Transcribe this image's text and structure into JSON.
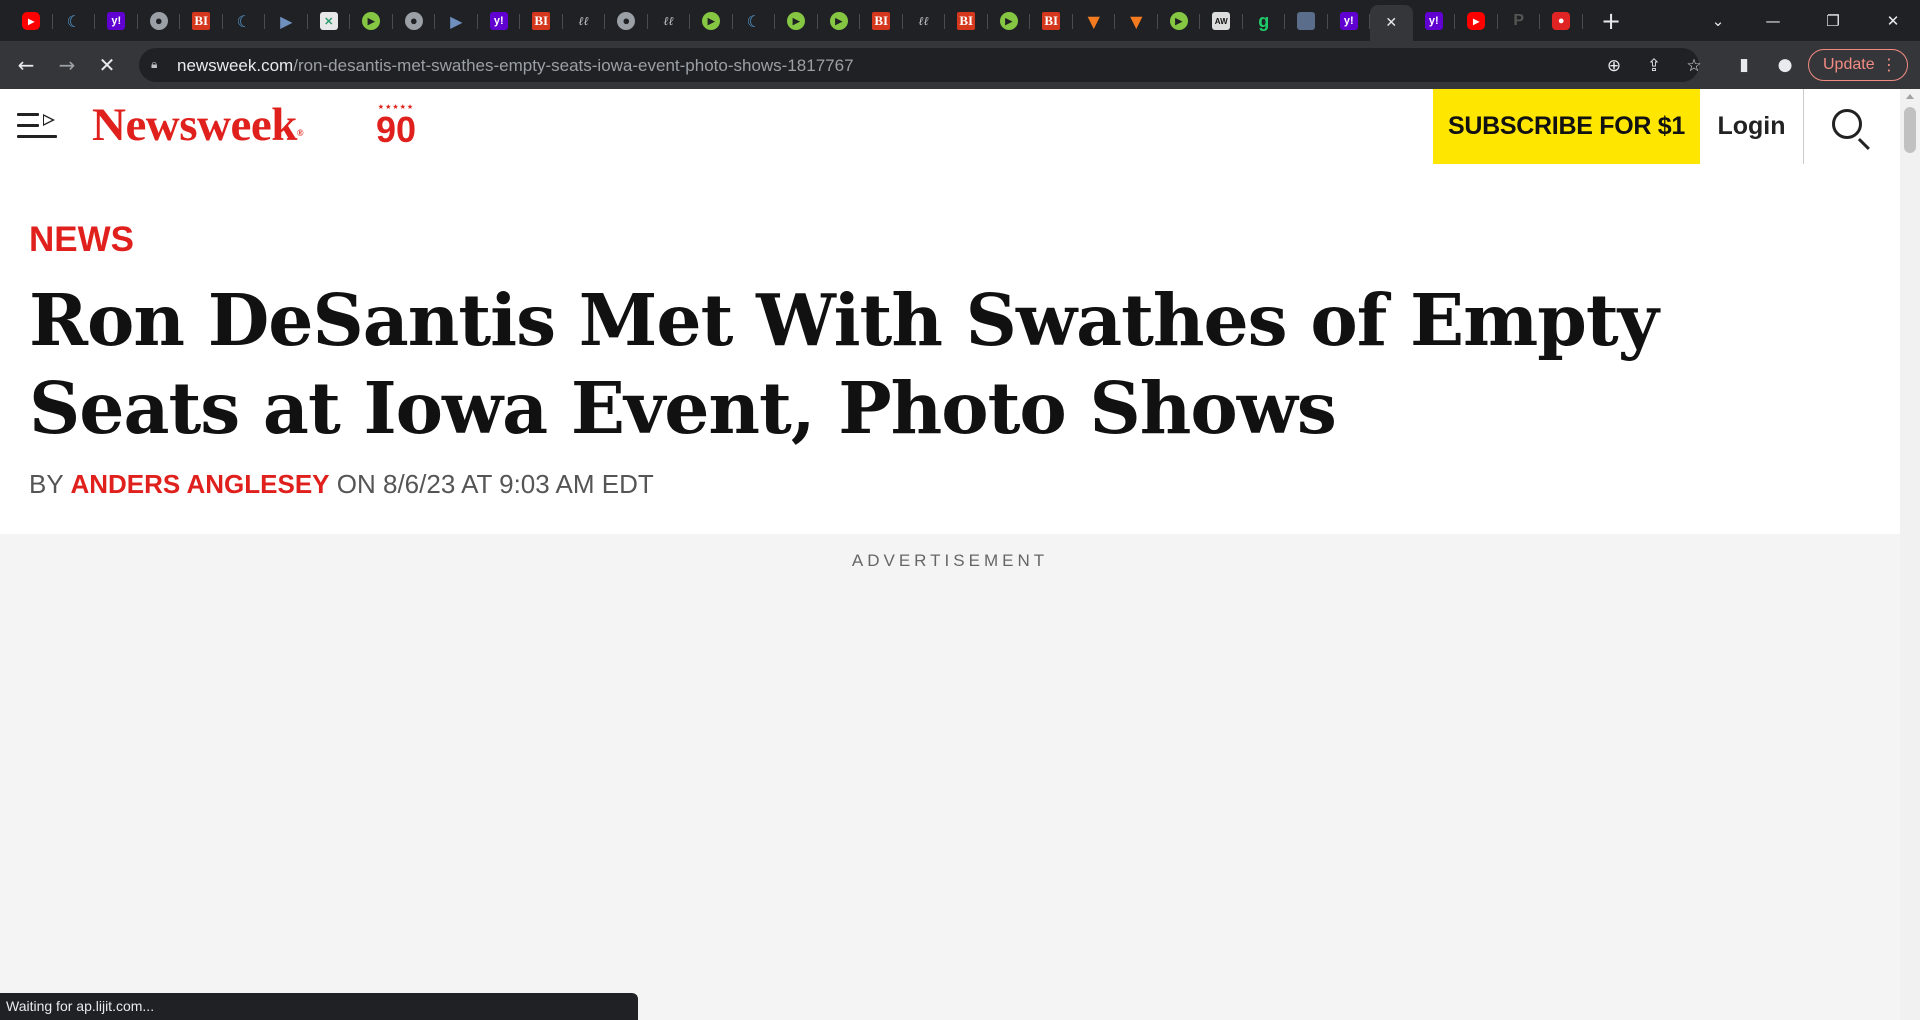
{
  "browser": {
    "tabs": [
      {
        "icon": "youtube-icon",
        "glyph": "▶"
      },
      {
        "icon": "shield-icon",
        "glyph": "☾"
      },
      {
        "icon": "yahoo-icon",
        "glyph": "y!"
      },
      {
        "icon": "globe-icon",
        "glyph": "●"
      },
      {
        "icon": "business-insider-icon",
        "glyph": "BI"
      },
      {
        "icon": "shield-icon",
        "glyph": "☾"
      },
      {
        "icon": "arrow-icon",
        "glyph": "▶"
      },
      {
        "icon": "grid-icon",
        "glyph": "✕"
      },
      {
        "icon": "rumble-icon",
        "glyph": "▶"
      },
      {
        "icon": "globe-icon",
        "glyph": "●"
      },
      {
        "icon": "arrow-icon",
        "glyph": "▶"
      },
      {
        "icon": "yahoo-icon",
        "glyph": "y!"
      },
      {
        "icon": "business-insider-icon",
        "glyph": "BI"
      },
      {
        "icon": "ll-icon",
        "glyph": "ℓℓ"
      },
      {
        "icon": "globe-icon",
        "glyph": "●"
      },
      {
        "icon": "ll-icon",
        "glyph": "ℓℓ"
      },
      {
        "icon": "rumble-icon",
        "glyph": "▶"
      },
      {
        "icon": "shield-icon",
        "glyph": "☾"
      },
      {
        "icon": "rumble-icon",
        "glyph": "▶"
      },
      {
        "icon": "rumble-icon",
        "glyph": "▶"
      },
      {
        "icon": "business-insider-icon",
        "glyph": "BI"
      },
      {
        "icon": "ll-icon",
        "glyph": "ℓℓ"
      },
      {
        "icon": "business-insider-icon",
        "glyph": "BI"
      },
      {
        "icon": "rumble-icon",
        "glyph": "▶"
      },
      {
        "icon": "business-insider-icon",
        "glyph": "BI"
      },
      {
        "icon": "bookmark-icon",
        "glyph": "▼"
      },
      {
        "icon": "bookmark-icon",
        "glyph": "▼"
      },
      {
        "icon": "rumble-icon",
        "glyph": "▶"
      },
      {
        "icon": "aw-icon",
        "glyph": "AW"
      },
      {
        "icon": "g-icon",
        "glyph": "g"
      },
      {
        "icon": "photo-icon",
        "glyph": ""
      },
      {
        "icon": "yahoo-icon",
        "glyph": "y!"
      },
      {
        "icon": "close-icon",
        "glyph": "✕",
        "active": true
      },
      {
        "icon": "yahoo-icon",
        "glyph": "y!"
      },
      {
        "icon": "youtube-icon",
        "glyph": "▶"
      },
      {
        "icon": "p-icon",
        "glyph": "P"
      },
      {
        "icon": "mic-icon",
        "glyph": "●"
      }
    ],
    "new_tab_glyph": "+",
    "window_controls": {
      "dropdown": "⌄",
      "minimize": "—",
      "restore": "❐",
      "close": "✕"
    },
    "nav": {
      "back": "←",
      "forward": "→",
      "stop": "✕"
    },
    "url_host": "newsweek.com",
    "url_path": "/ron-desantis-met-swathes-empty-seats-iowa-event-photo-shows-1817767",
    "omnibox_icons": {
      "zoom": "⊕",
      "share": "⇪",
      "bookmark": "☆"
    },
    "toolbar_icons": {
      "sidepanel": "▮",
      "profile": "●"
    },
    "update_label": "Update",
    "menu_glyph": "⋮",
    "status_text": "Waiting for ap.lijit.com..."
  },
  "site": {
    "logo_text": "Newsweek",
    "logo_reg": "®",
    "anniversary_stars": "★★★★★",
    "anniversary_number": "90",
    "subscribe_label": "SUBSCRIBE FOR $1",
    "login_label": "Login"
  },
  "article": {
    "section": "NEWS",
    "headline": "Ron DeSantis Met With Swathes of Empty Seats at Iowa Event, Photo Shows",
    "byline_prefix": "BY",
    "author": "ANDERS ANGLESEY",
    "date_text": "ON 8/6/23 AT 9:03 AM EDT"
  },
  "ad": {
    "label": "ADVERTISEMENT"
  },
  "colors": {
    "brand_red": "#e0201c",
    "subscribe_yellow": "#ffe600",
    "chrome_dark": "#202124",
    "chrome_toolbar": "#35363a"
  }
}
